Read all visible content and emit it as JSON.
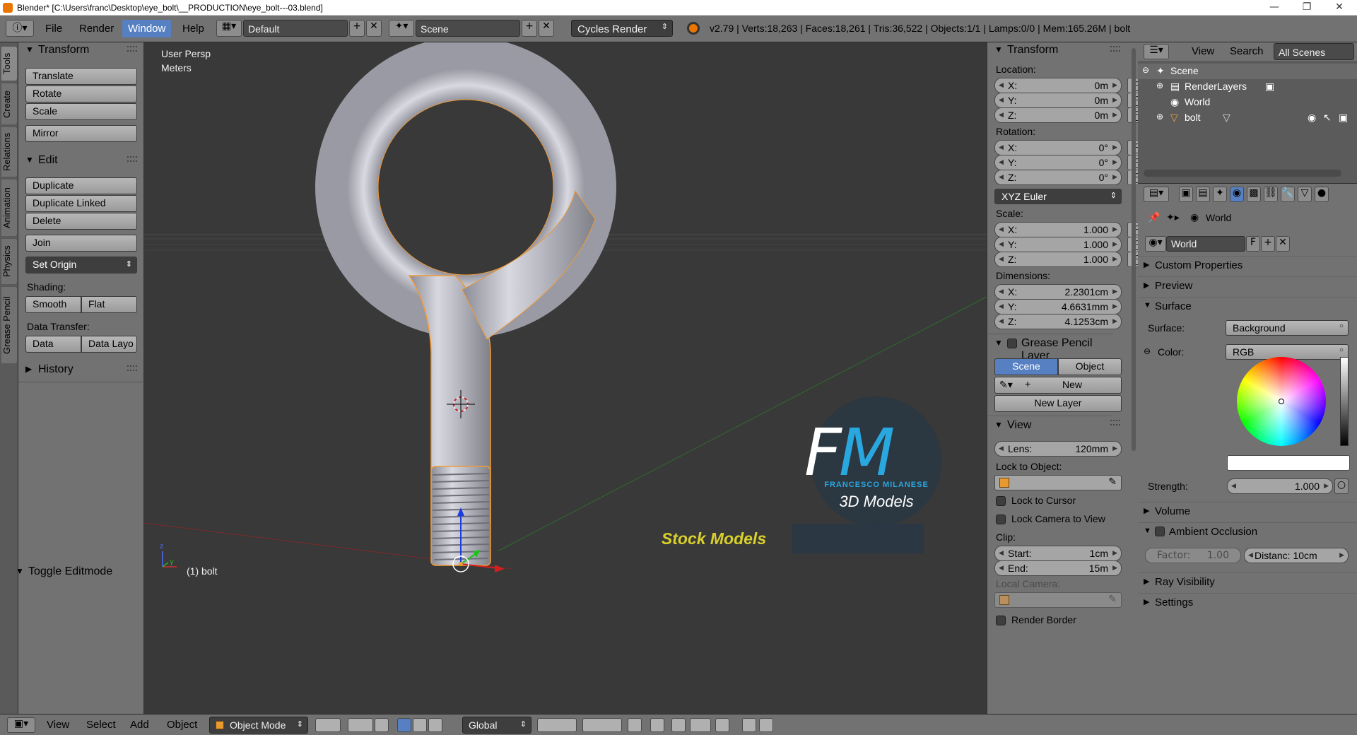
{
  "window": {
    "title": "Blender* [C:\\Users\\franc\\Desktop\\eye_bolt\\__PRODUCTION\\eye_bolt---03.blend]",
    "minimize": "—",
    "maximize": "❐",
    "close": "✕"
  },
  "header": {
    "menus": [
      "File",
      "Render",
      "Window",
      "Help"
    ],
    "layout": "Default",
    "scene": "Scene",
    "engine": "Cycles Render",
    "stats": "v2.79 | Verts:18,263 | Faces:18,261 | Tris:36,522 | Objects:1/1 | Lamps:0/0 | Mem:165.26M | bolt"
  },
  "tool_tabs": [
    "Tools",
    "Create",
    "Relations",
    "Animation",
    "Physics",
    "Grease Pencil"
  ],
  "tool_shelf": {
    "transform": {
      "title": "Transform",
      "buttons": [
        "Translate",
        "Rotate",
        "Scale",
        "Mirror"
      ]
    },
    "edit": {
      "title": "Edit",
      "buttons": [
        "Duplicate",
        "Duplicate Linked",
        "Delete",
        "Join"
      ],
      "set_origin": "Set Origin",
      "shading_label": "Shading:",
      "shading_buttons": [
        "Smooth",
        "Flat"
      ],
      "data_transfer_label": "Data Transfer:",
      "data_buttons": [
        "Data",
        "Data Layo"
      ]
    },
    "history": "History",
    "toggle_editmode": "Toggle Editmode"
  },
  "viewport": {
    "view_name": "User Persp",
    "units": "Meters",
    "object_label": "(1) bolt",
    "watermark": {
      "initials": "FM",
      "author": "FRANCESCO MILANESE",
      "subtitle": "3D Models",
      "banner": "Stock Models"
    }
  },
  "n_panel": {
    "transform_title": "Transform",
    "location_label": "Location:",
    "location": [
      {
        "k": "X:",
        "v": "0m"
      },
      {
        "k": "Y:",
        "v": "0m"
      },
      {
        "k": "Z:",
        "v": "0m"
      }
    ],
    "rotation_label": "Rotation:",
    "rotation": [
      {
        "k": "X:",
        "v": "0°"
      },
      {
        "k": "Y:",
        "v": "0°"
      },
      {
        "k": "Z:",
        "v": "0°"
      }
    ],
    "rotation_mode": "XYZ Euler",
    "scale_label": "Scale:",
    "scale": [
      {
        "k": "X:",
        "v": "1.000"
      },
      {
        "k": "Y:",
        "v": "1.000"
      },
      {
        "k": "Z:",
        "v": "1.000"
      }
    ],
    "dimensions_label": "Dimensions:",
    "dimensions": [
      {
        "k": "X:",
        "v": "2.2301cm"
      },
      {
        "k": "Y:",
        "v": "4.6631mm"
      },
      {
        "k": "Z:",
        "v": "4.1253cm"
      }
    ],
    "grease_title": "Grease Pencil Layer",
    "gp_tabs": [
      "Scene",
      "Object"
    ],
    "gp_new": "New",
    "gp_new_layer": "New Layer",
    "view_title": "View",
    "lens_label": "Lens:",
    "lens_value": "120mm",
    "lock_to_object": "Lock to Object:",
    "lock_to_cursor": "Lock to Cursor",
    "lock_camera": "Lock Camera to View",
    "clip_label": "Clip:",
    "clip_start_label": "Start:",
    "clip_start": "1cm",
    "clip_end_label": "End:",
    "clip_end": "15m",
    "local_camera": "Local Camera:",
    "render_border": "Render Border"
  },
  "outliner": {
    "head": [
      "View",
      "Search",
      "All Scenes"
    ],
    "rows": [
      "Scene",
      "RenderLayers",
      "World",
      "bolt"
    ]
  },
  "properties": {
    "context": "World",
    "world_name": "World",
    "fake_user": "F",
    "panels": [
      "Custom Properties",
      "Preview",
      "Surface"
    ],
    "surface_label": "Surface:",
    "surface_value": "Background",
    "color_label": "Color:",
    "color_value": "RGB",
    "strength_label": "Strength:",
    "strength_value": "1.000",
    "panels_after": [
      "Volume",
      "Ambient Occlusion"
    ],
    "ao_factor_label": "Factor:",
    "ao_factor": "1.00",
    "ao_distance": "Distanc: 10cm",
    "panels_end": [
      "Ray Visibility",
      "Settings"
    ]
  },
  "footer": {
    "menus": [
      "View",
      "Select",
      "Add",
      "Object"
    ],
    "mode": "Object Mode",
    "orientation": "Global"
  },
  "colors": {
    "accent": "#5680c2",
    "panel": "#727272",
    "viewport": "#393939",
    "selection_outline": "#f19a36",
    "watermark_blue": "#29a8e0",
    "watermark_yellow": "#d9d12a"
  }
}
